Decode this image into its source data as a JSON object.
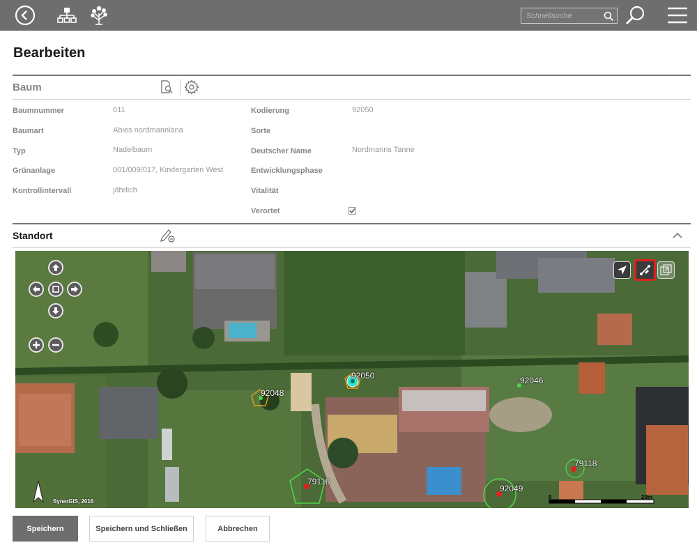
{
  "topbar": {
    "icons": [
      "back-circle-icon",
      "sitemap-icon",
      "tree-icon",
      "search-icon",
      "zoom-search-icon",
      "menu-icon"
    ],
    "search_placeholder": "Schnellsuche"
  },
  "page": {
    "title": "Bearbeiten"
  },
  "baum_section": {
    "title": "Baum",
    "icons": [
      "document-search-icon",
      "gear-icon"
    ],
    "fields_left": [
      {
        "label": "Baumnummer",
        "value": "011"
      },
      {
        "label": "Baumart",
        "value": "Abies nordmanniana"
      },
      {
        "label": "Typ",
        "value": "Nadelbaum"
      },
      {
        "label": "Grünanlage",
        "value": "001/009/017, Kindergarten West"
      },
      {
        "label": "Kontrollintervall",
        "value": "jährlich"
      }
    ],
    "fields_right": [
      {
        "label": "Kodierung",
        "value": "92050"
      },
      {
        "label": "Sorte",
        "value": ""
      },
      {
        "label": "Deutscher Name",
        "value": "Nordmanns Tanne"
      },
      {
        "label": "Entwicklungsphase",
        "value": ""
      },
      {
        "label": "Vitalität",
        "value": ""
      },
      {
        "label": "Verortet",
        "value": "",
        "checked": true
      }
    ]
  },
  "standort_section": {
    "title": "Standort",
    "icons": [
      "pencil-edit-icon",
      "chevron-up-icon"
    ]
  },
  "map": {
    "tree_labels": [
      "92050",
      "92048",
      "92046",
      "79118",
      "79116",
      "92049"
    ],
    "copyright": "SynerGIS, 2016",
    "scale_start": "0",
    "scale_end": "20m",
    "tools": [
      "locate-arrow-icon",
      "edit-geometry-icon",
      "layers-icon"
    ]
  },
  "buttons": {
    "save": "Speichern",
    "save_close": "Speichern und Schließen",
    "cancel": "Abbrechen"
  },
  "colors": {
    "topbar": "#6e6e6e",
    "primary_button": "#6e6e6e",
    "highlight": "#e0201c",
    "selected_tree": "#2ee6c8"
  }
}
